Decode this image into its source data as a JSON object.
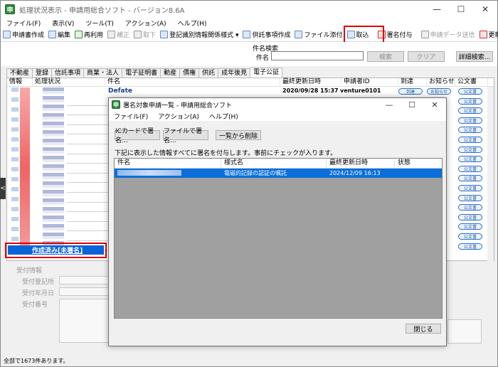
{
  "app": {
    "title": "処理状況表示 - 申請用総合ソフト - バージョン8.6A",
    "icon_text": "申",
    "controls": {
      "minimize": "—",
      "maximize": "☐",
      "close": "✕"
    }
  },
  "menu": [
    "ファイル(F)",
    "表示(V)",
    "ツール(T)",
    "アクション(A)",
    "ヘルプ(H)"
  ],
  "toolbar": [
    {
      "label": "申請書作成",
      "enabled": true
    },
    {
      "label": "編集",
      "enabled": true
    },
    {
      "label": "再利用",
      "enabled": true
    },
    {
      "label": "補正",
      "enabled": false
    },
    {
      "label": "取下",
      "enabled": false
    },
    {
      "label": "登記識別情報関係様式 ▾",
      "enabled": true
    },
    {
      "label": "供託事項作成",
      "enabled": true
    },
    {
      "label": "ファイル添付",
      "enabled": true
    },
    {
      "label": "取込",
      "enabled": true
    },
    {
      "label": "署名付与",
      "enabled": true
    },
    {
      "label": "申請データ送信",
      "enabled": false
    },
    {
      "label": "更新",
      "enabled": true
    }
  ],
  "search": {
    "heading": "件名検索",
    "field_label": "件名",
    "value": "",
    "search_button": "検索",
    "clear_button": "クリア",
    "advanced_button": "詳細検索..."
  },
  "tabs": [
    "不動産",
    "登録",
    "信託事項",
    "商業・法人",
    "電子証明書",
    "動産",
    "債権",
    "供託",
    "成年後見",
    "電子公証"
  ],
  "active_tab": "電子公証",
  "table": {
    "columns": [
      "情報",
      "処理状況",
      "件名",
      "最終更新日時",
      "申請者ID",
      "到達",
      "お知らせ",
      "公文書"
    ],
    "first_row": {
      "subject": "Defate",
      "updated": "2020/09/28 15:37",
      "applicant": "venture0101",
      "arrival": "到達",
      "notice": "お知らせ",
      "document": "公文書"
    },
    "pill_label": "公文書",
    "selected_status": "作成済み[未署名]"
  },
  "detail": {
    "section": "受付情報",
    "office_label": "受付登記所",
    "date_label": "受付年月日",
    "number_label": "受付番号"
  },
  "statusbar": "全部で1673件あります。",
  "dialog": {
    "title": "署名対象申請一覧 - 申請用総合ソフト",
    "menu": [
      "ファイル(F)",
      "アクション(A)",
      "ヘルプ(H)"
    ],
    "buttons": {
      "ic_sign": "ICカードで署名...",
      "file_sign": "ファイルで署名...",
      "remove": "一覧から削除",
      "close": "閉じる"
    },
    "instruction": "下記に表示した情報すべてに署名を付与します。事前にチェックが入ります。",
    "columns": [
      "件名",
      "様式名",
      "最終更新日時",
      "状態"
    ],
    "row": {
      "form": "電磁的記録の認証の嘱託",
      "updated": "2024/12/09 16:13",
      "state": ""
    }
  },
  "colors": {
    "selection": "#0a64d8",
    "highlight": "#e00000"
  }
}
